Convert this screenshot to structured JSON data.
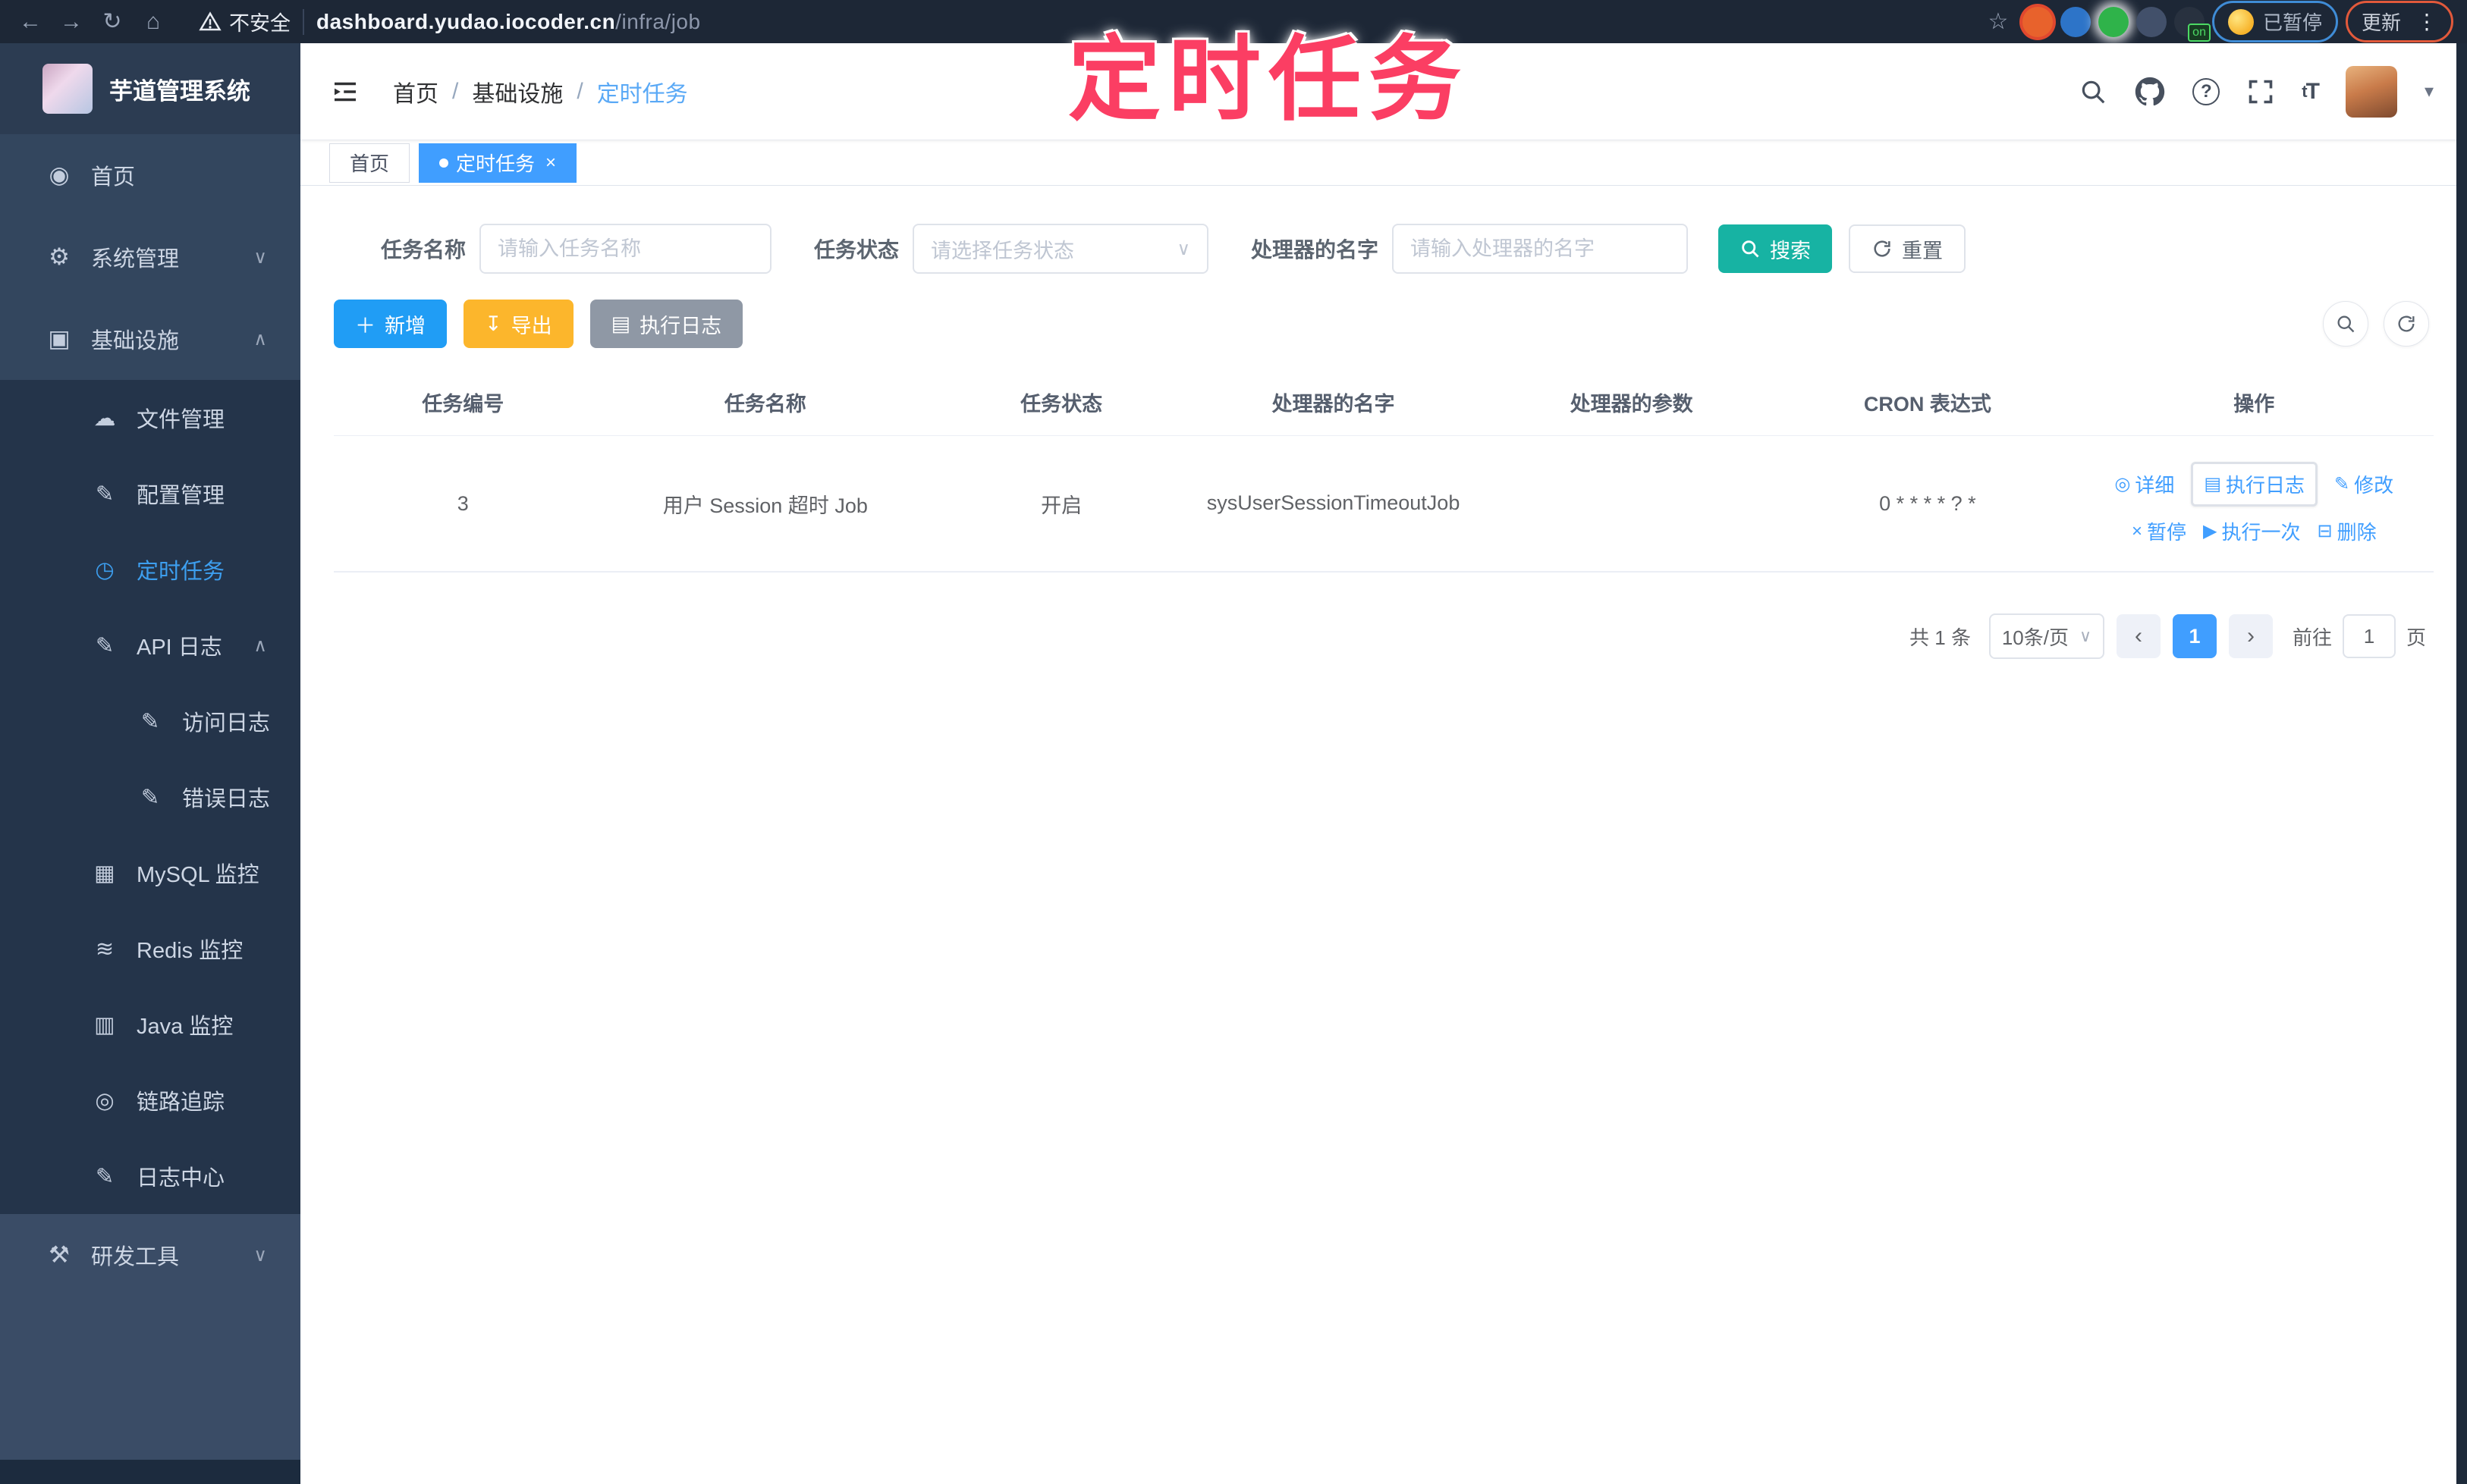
{
  "browser": {
    "security_warning": "不安全",
    "url_domain": "dashboard.yudao.iocoder.cn",
    "url_path": "/infra/job",
    "extension_badge": "on",
    "paused_badge": "已暂停",
    "update_button": "更新"
  },
  "icons": {
    "back": "←",
    "forward": "→",
    "reload": "↻",
    "home": "⌂",
    "star": "☆",
    "menu_dots": "⋮",
    "caret_down": "▾",
    "chevron_down": "∨",
    "chevron_up": "∧",
    "select_caret": "∨",
    "dashboard": "◉",
    "gear": "⚙",
    "board": "▣",
    "cloud": "☁",
    "edit": "✎",
    "clock": "◷",
    "doc": "▤",
    "grid": "▦",
    "layers": "≋",
    "monitor": "▥",
    "eye": "◎",
    "tools": "⚒",
    "plus": "＋",
    "download": "↧",
    "list": "▤",
    "close": "×",
    "play": "▶",
    "trash": "⊟",
    "prev": "‹",
    "next": "›",
    "help": "?"
  },
  "sidebar": {
    "app_title": "芋道管理系统",
    "home": "首页",
    "system": "系统管理",
    "infra": "基础设施",
    "devtools": "研发工具",
    "submenu": {
      "file": "文件管理",
      "config": "配置管理",
      "job": "定时任务",
      "api_log": "API 日志",
      "access_log": "访问日志",
      "error_log": "错误日志",
      "mysql": "MySQL 监控",
      "redis": "Redis 监控",
      "java": "Java 监控",
      "trace": "链路追踪",
      "log_center": "日志中心"
    }
  },
  "navbar": {
    "breadcrumb": [
      "首页",
      "基础设施",
      "定时任务"
    ],
    "separator": "/",
    "font_icon": "tT"
  },
  "tabs": [
    {
      "label": "首页"
    },
    {
      "label": "定时任务"
    }
  ],
  "overlay": {
    "title": "定时任务"
  },
  "filters": {
    "name_label": "任务名称",
    "name_placeholder": "请输入任务名称",
    "status_label": "任务状态",
    "status_placeholder": "请选择任务状态",
    "handler_label": "处理器的名字",
    "handler_placeholder": "请输入处理器的名字",
    "search_label": "搜索",
    "reset_label": "重置"
  },
  "toolbar": {
    "add_label": "新增",
    "export_label": "导出",
    "run_log_label": "执行日志"
  },
  "table": {
    "headers": [
      "任务编号",
      "任务名称",
      "任务状态",
      "处理器的名字",
      "处理器的参数",
      "CRON 表达式",
      "操作"
    ],
    "rows": [
      {
        "id": "3",
        "name": "用户 Session 超时 Job",
        "status": "开启",
        "handler": "sysUserSessionTimeoutJob",
        "params": "",
        "cron": "0 * * * * ? *"
      }
    ],
    "actions": {
      "detail": "详细",
      "run_log": "执行日志",
      "edit": "修改",
      "pause": "暂停",
      "run_once": "执行一次",
      "delete": "删除"
    }
  },
  "pagination": {
    "total": "共 1 条",
    "page_size": "10条/页",
    "current_page": "1",
    "goto_label": "前往",
    "goto_value": "1",
    "page_unit": "页"
  },
  "colors": {
    "primary": "#409eff",
    "search_teal": "#17b3a3",
    "export_amber": "#fcb62c",
    "info_gray": "#8f98a5",
    "annotation_pink": "#fb3e63",
    "sidebar_bg": "#33465e",
    "submenu_bg": "#24344a"
  }
}
